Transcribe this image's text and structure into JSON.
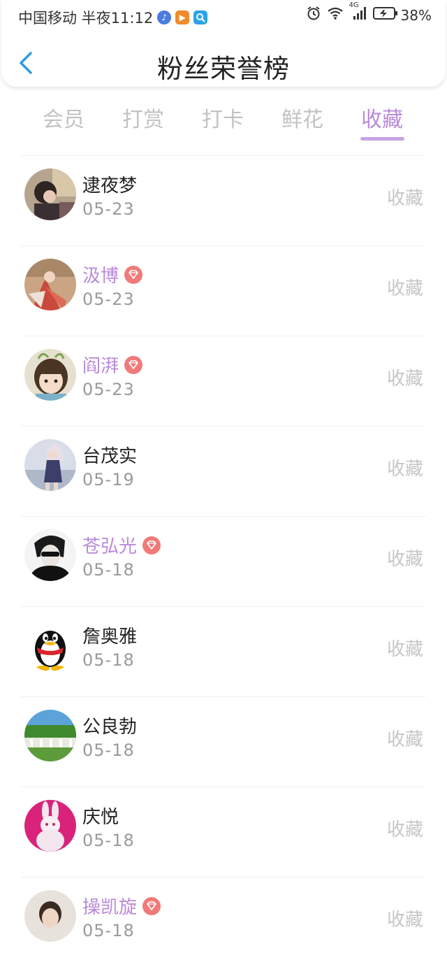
{
  "status_bar": {
    "carrier": "中国移动 半夜11:12",
    "network": "4G",
    "battery": "38%"
  },
  "header": {
    "title": "粉丝荣誉榜",
    "back_icon": "chevron-left-icon"
  },
  "tabs": [
    {
      "label": "会员",
      "active": false
    },
    {
      "label": "打赏",
      "active": false
    },
    {
      "label": "打卡",
      "active": false
    },
    {
      "label": "鲜花",
      "active": false
    },
    {
      "label": "收藏",
      "active": true
    }
  ],
  "colors": {
    "accent": "#b98ad8",
    "back_arrow": "#2f9be8",
    "vip_badge": "#f07a7a"
  },
  "list": [
    {
      "name": "逮夜梦",
      "date": "05-23",
      "action": "收藏",
      "vip": false
    },
    {
      "name": "汲博",
      "date": "05-23",
      "action": "收藏",
      "vip": true
    },
    {
      "name": "阎湃",
      "date": "05-23",
      "action": "收藏",
      "vip": true
    },
    {
      "name": "台茂实",
      "date": "05-19",
      "action": "收藏",
      "vip": false
    },
    {
      "name": "苍弘光",
      "date": "05-18",
      "action": "收藏",
      "vip": true
    },
    {
      "name": "詹奥雅",
      "date": "05-18",
      "action": "收藏",
      "vip": false
    },
    {
      "name": "公良勃",
      "date": "05-18",
      "action": "收藏",
      "vip": false
    },
    {
      "name": "庆悦",
      "date": "05-18",
      "action": "收藏",
      "vip": false
    },
    {
      "name": "操凯旋",
      "date": "05-18",
      "action": "收藏",
      "vip": true
    }
  ]
}
